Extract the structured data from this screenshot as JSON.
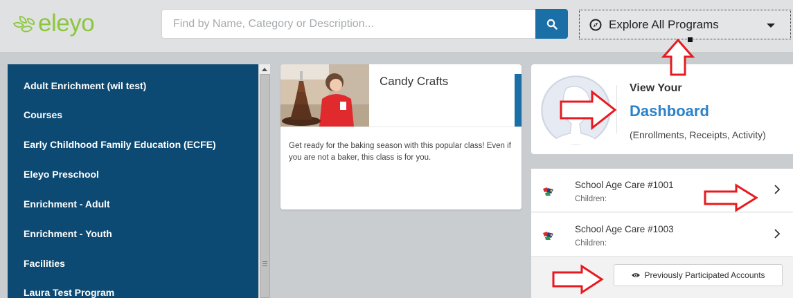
{
  "header": {
    "logo_text": "eleyo",
    "search": {
      "placeholder": "Find by Name, Category or Description..."
    },
    "explore": {
      "label": "Explore All Programs"
    }
  },
  "sidebar": {
    "items": [
      {
        "label": "Adult Enrichment (wil test)"
      },
      {
        "label": "Courses"
      },
      {
        "label": "Early Childhood Family Education (ECFE)"
      },
      {
        "label": "Eleyo Preschool"
      },
      {
        "label": "Enrichment - Adult"
      },
      {
        "label": "Enrichment - Youth"
      },
      {
        "label": "Facilities"
      },
      {
        "label": "Laura Test Program"
      }
    ]
  },
  "program_card": {
    "title": "Candy Crafts",
    "description": "Get ready for the baking season with this popular class! Even if you are not a baker, this class is for you."
  },
  "dashboard": {
    "view_label": "View Your",
    "title": "Dashboard",
    "subtitle": "(Enrollments, Receipts, Activity)"
  },
  "accounts": {
    "rows": [
      {
        "name": "School Age Care #1001",
        "sub": "Children:"
      },
      {
        "name": "School Age Care #1003",
        "sub": "Children:"
      }
    ],
    "previous_button": "Previously Participated Accounts"
  },
  "colors": {
    "sidebar_bg": "#0d4a73",
    "accent_blue": "#1a6fa7",
    "dashboard_link": "#2b82c9",
    "logo_green": "#8cc63f",
    "annotation_red": "#e8191f"
  },
  "icons": [
    "leaf-logo-icon",
    "search-icon",
    "compass-icon",
    "chevron-down-icon",
    "user-avatar-icon",
    "account-flag-icon",
    "chevron-right-icon",
    "eye-icon",
    "red-arrow-icon"
  ]
}
